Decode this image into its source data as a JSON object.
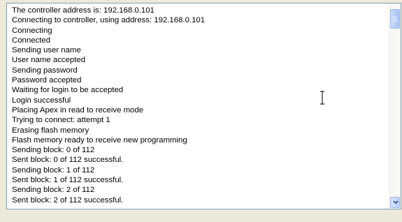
{
  "log": {
    "lines": [
      "The controller address is: 192.168.0.101",
      "Connecting to controller, using address: 192.168.0.101",
      "Connecting",
      "Connected",
      "Sending user name",
      "User name accepted",
      "Sending password",
      "Password accepted",
      "Waiting for login to be accepted",
      "Login successful",
      "Placing Apex in read to receive mode",
      "Trying to connect: attempt 1",
      "Erasing flash memory",
      "Flash memory ready to receive new programming",
      "Sending block: 0 of 112",
      "Sent block: 0 of 112 successful.",
      "Sending block: 1 of 112",
      "Sent block: 1 of 112 successful.",
      "Sending block: 2 of 112",
      "Sent block: 2 of 112 successful."
    ]
  },
  "scrollbar": {
    "up_icon": "chevron-up-icon",
    "down_icon": "chevron-down-icon"
  },
  "cursor": {
    "icon": "text-cursor-icon"
  }
}
